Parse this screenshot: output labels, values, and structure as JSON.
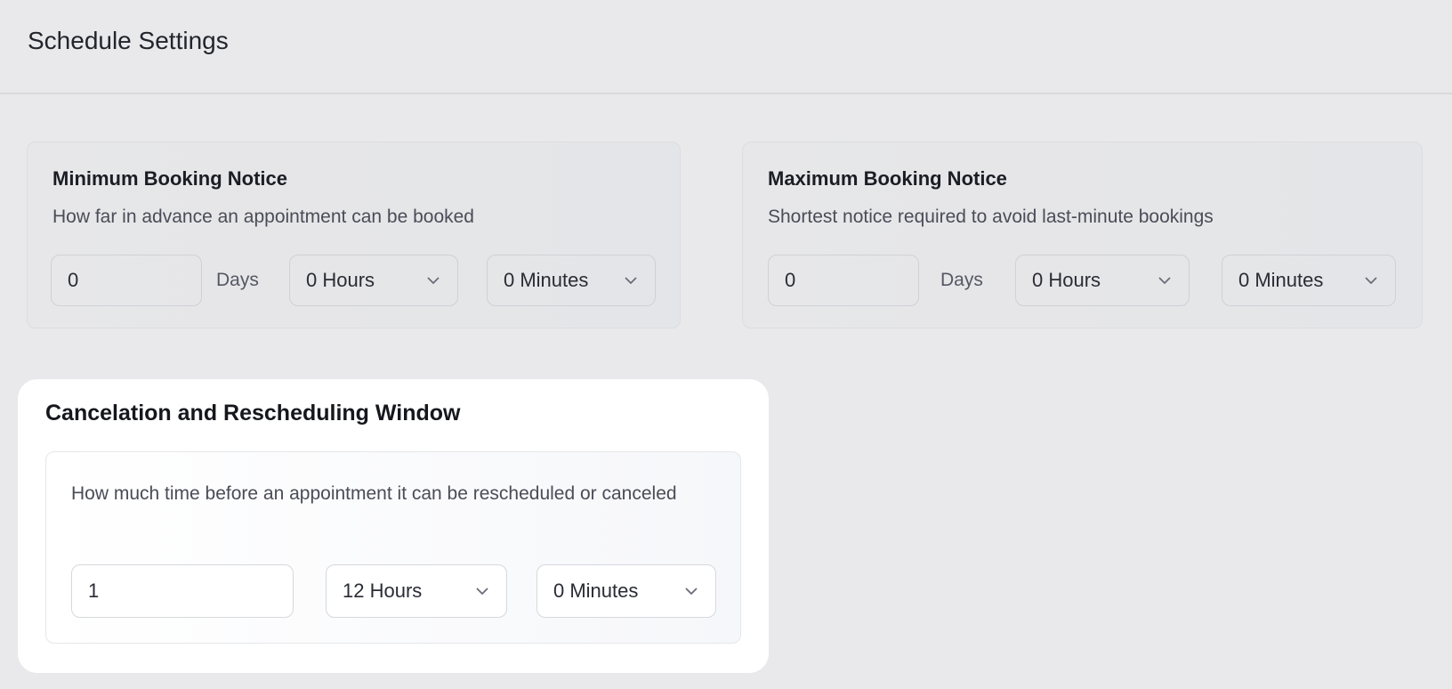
{
  "page": {
    "title": "Schedule Settings"
  },
  "min_notice": {
    "title": "Minimum Booking Notice",
    "description": "How far in advance an appointment can be booked",
    "days_value": "0",
    "days_label": "Days",
    "hours_value": "0 Hours",
    "minutes_value": "0 Minutes"
  },
  "max_notice": {
    "title": "Maximum Booking Notice",
    "description": "Shortest notice required to avoid last-minute bookings",
    "days_value": "0",
    "days_label": "Days",
    "hours_value": "0 Hours",
    "minutes_value": "0 Minutes"
  },
  "cancel_window": {
    "title": "Cancelation and Rescheduling Window",
    "description": "How much time before an appointment it can be rescheduled or canceled",
    "days_value": "1",
    "hours_value": "12 Hours",
    "minutes_value": "0 Minutes"
  },
  "icons": {
    "dropdown": "chevron-down-icon"
  },
  "colors": {
    "background": "#e9e9eb",
    "panel": "#ffffff",
    "border": "#cfd1d7",
    "text": "#22242c"
  }
}
